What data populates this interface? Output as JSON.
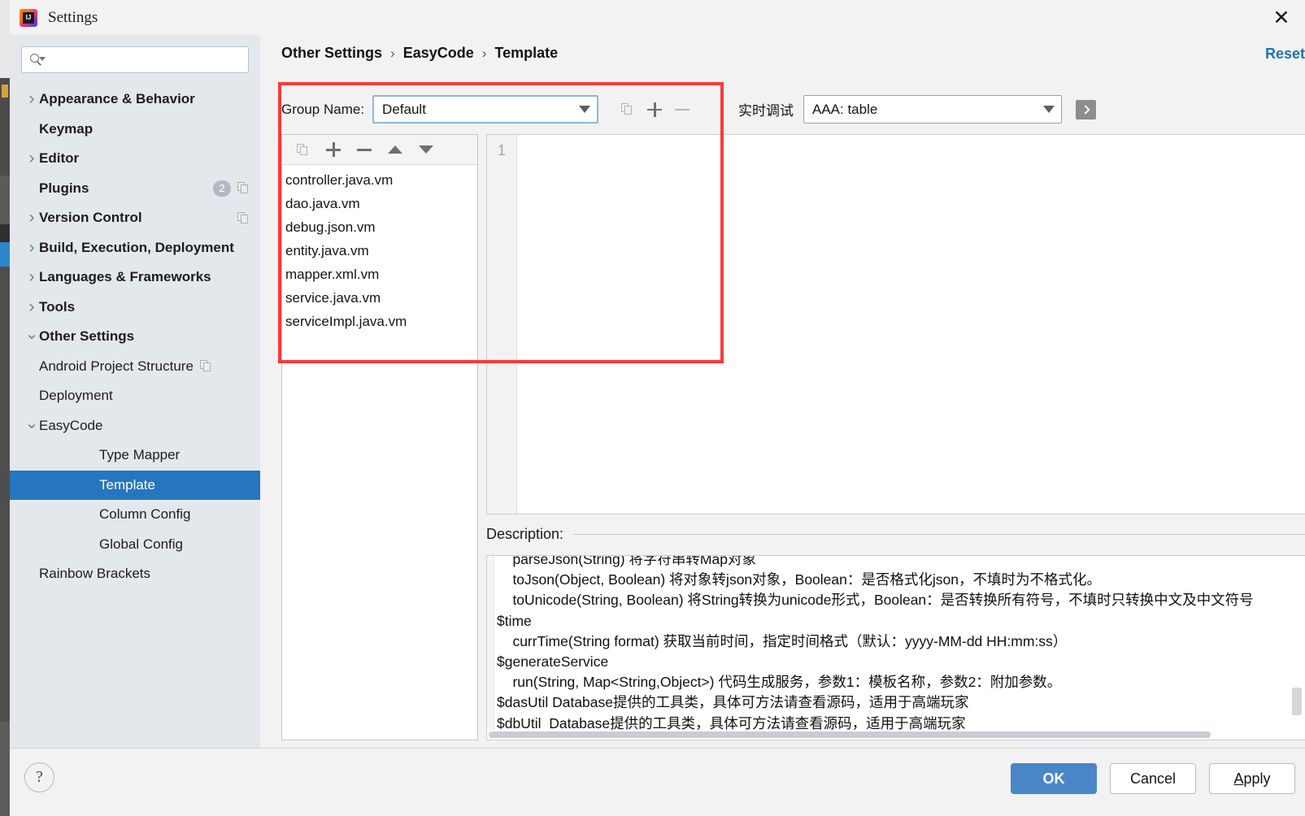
{
  "window": {
    "title": "Settings",
    "logo_text": "IJ",
    "close_label": "✕"
  },
  "sidebar": {
    "search": {
      "placeholder": "",
      "value": "",
      "icon": "search-icon"
    },
    "items": [
      {
        "label": "Appearance & Behavior",
        "level": 0,
        "arrow": "collapsed",
        "bold": true
      },
      {
        "label": "Keymap",
        "level": 0,
        "arrow": "none",
        "bold": true
      },
      {
        "label": "Editor",
        "level": 0,
        "arrow": "collapsed",
        "bold": true
      },
      {
        "label": "Plugins",
        "level": 0,
        "arrow": "none",
        "bold": true,
        "badge": "2",
        "copy_icon": true
      },
      {
        "label": "Version Control",
        "level": 0,
        "arrow": "collapsed",
        "bold": true,
        "copy_icon": true
      },
      {
        "label": "Build, Execution, Deployment",
        "level": 0,
        "arrow": "collapsed",
        "bold": true
      },
      {
        "label": "Languages & Frameworks",
        "level": 0,
        "arrow": "collapsed",
        "bold": true
      },
      {
        "label": "Tools",
        "level": 0,
        "arrow": "collapsed",
        "bold": true
      },
      {
        "label": "Other Settings",
        "level": 0,
        "arrow": "expanded",
        "bold": true
      },
      {
        "label": "Android Project Structure",
        "level": 1,
        "arrow": "none",
        "inline_copy": true
      },
      {
        "label": "Deployment",
        "level": 1,
        "arrow": "none"
      },
      {
        "label": "EasyCode",
        "level": 1,
        "arrow": "expanded"
      },
      {
        "label": "Type Mapper",
        "level": 2,
        "arrow": "none"
      },
      {
        "label": "Template",
        "level": 2,
        "arrow": "none",
        "selected": true
      },
      {
        "label": "Column Config",
        "level": 2,
        "arrow": "none"
      },
      {
        "label": "Global Config",
        "level": 2,
        "arrow": "none"
      },
      {
        "label": "Rainbow Brackets",
        "level": 1,
        "arrow": "none"
      }
    ]
  },
  "main": {
    "breadcrumb": [
      "Other Settings",
      "EasyCode",
      "Template"
    ],
    "breadcrumb_separator": "›",
    "reset_link": "Reset",
    "group": {
      "label": "Group Name:",
      "value": "Default",
      "copy_icon": "copy-icon",
      "add_icon": "plus-icon",
      "remove_icon": "minus-icon"
    },
    "debug": {
      "label": "实时调试",
      "value": "AAA: table",
      "run_icon": "run-icon"
    },
    "file_toolbar": {
      "copy": "copy-icon",
      "add": "plus-icon",
      "remove": "minus-icon",
      "move_up": "arrow-up-icon",
      "move_down": "arrow-down-icon"
    },
    "files": [
      "controller.java.vm",
      "dao.java.vm",
      "debug.json.vm",
      "entity.java.vm",
      "mapper.xml.vm",
      "service.java.vm",
      "serviceImpl.java.vm"
    ],
    "editor": {
      "line_numbers": [
        "1"
      ],
      "content": ""
    },
    "description": {
      "label": "Description:",
      "text": "    parseJson(String) 将字符串转Map对象\n    toJson(Object, Boolean) 将对象转json对象，Boolean：是否格式化json，不填时为不格式化。\n    toUnicode(String, Boolean) 将String转换为unicode形式，Boolean：是否转换所有符号，不填时只转换中文及中文符号\n$time\n    currTime(String format) 获取当前时间，指定时间格式（默认：yyyy-MM-dd HH:mm:ss）\n$generateService\n    run(String, Map<String,Object>) 代码生成服务，参数1：模板名称，参数2：附加参数。\n$dasUtil Database提供的工具类，具体可方法请查看源码，适用于高端玩家\n$dbUtil  Database提供的工具类，具体可方法请查看源码，适用于高端玩家"
    }
  },
  "footer": {
    "help": "?",
    "buttons": [
      {
        "label": "OK",
        "primary": true
      },
      {
        "label": "Cancel",
        "primary": false
      },
      {
        "label": "Apply",
        "primary": false,
        "mnemonic": "A"
      }
    ]
  },
  "colors": {
    "accent": "#2675bf",
    "primary_button": "#4a86c5",
    "link": "#2470b8",
    "annotation": "#fa3a3a",
    "sidebar_bg": "#e3e8ed"
  }
}
